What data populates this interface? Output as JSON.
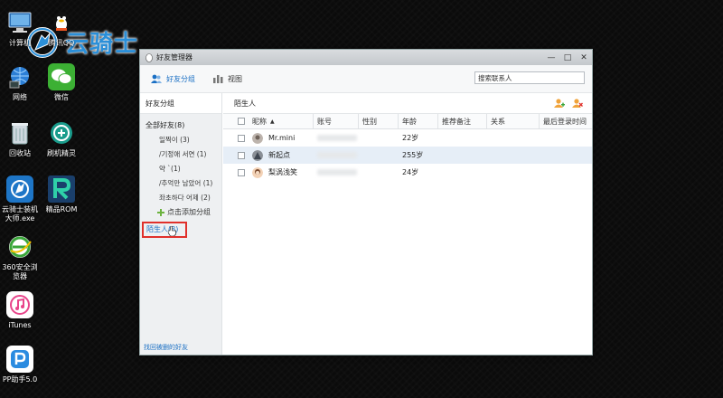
{
  "watermark": {
    "brand": "云骑士"
  },
  "desktop_icons": [
    {
      "label": "计算机",
      "icon": "computer-icon"
    },
    {
      "label": "腾讯QQ",
      "icon": "qq-icon"
    },
    {
      "label": "网络",
      "icon": "network-icon"
    },
    {
      "label": "微信",
      "icon": "wechat-icon"
    },
    {
      "label": "回收站",
      "icon": "recycle-bin-icon"
    },
    {
      "label": "刷机精灵",
      "icon": "shuaji-icon"
    },
    {
      "label": "云骑士装机大师.exe",
      "icon": "yunqishi-icon"
    },
    {
      "label": "精品ROM",
      "icon": "rom-icon"
    },
    {
      "label": "360安全浏览器",
      "icon": "browser-360-icon"
    },
    {
      "label": "iTunes",
      "icon": "itunes-icon"
    },
    {
      "label": "PP助手5.0",
      "icon": "pp-icon"
    }
  ],
  "window": {
    "title": "好友管理器",
    "controls": {
      "minimize": "—",
      "maximize": "□",
      "close": "✕"
    },
    "toolbar": {
      "friend_groups": "好友分组",
      "view": "视图"
    },
    "search": {
      "placeholder": "搜索联系人"
    },
    "colors": {
      "accent": "#1a6fc4",
      "highlight": "#e0302b"
    }
  },
  "sidebar": {
    "header": "好友分组",
    "all_friends": "全部好友(8)",
    "groups": [
      "일찍이 (3)",
      "/기정애 서연 (1)",
      "약 `(1)",
      "/추억만 남았어 (1)",
      "좌초하다 어제 (2)"
    ],
    "add_group": "点击添加分组",
    "stranger": "陌生人(3)",
    "find_lost": "找回被删的好友"
  },
  "main": {
    "title": "陌生人",
    "columns": [
      "昵称",
      "账号",
      "性别",
      "年龄",
      "推荐备注",
      "关系",
      "最后登录时间"
    ],
    "rows": [
      {
        "nick": "Mr.mini",
        "age": "22岁"
      },
      {
        "nick": "新起点",
        "age": "255岁"
      },
      {
        "nick": "梨涡浅笑",
        "age": "24岁"
      }
    ]
  }
}
